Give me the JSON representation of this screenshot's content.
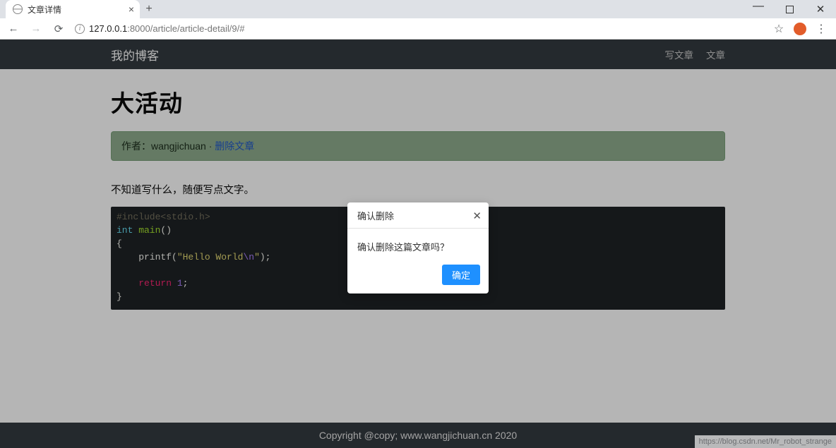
{
  "browser": {
    "tab_title": "文章详情",
    "url_prefix": "127.0.0.1",
    "url_rest": ":8000/article/article-detail/9/#",
    "status_url": "https://blog.csdn.net/Mr_robot_strange"
  },
  "navbar": {
    "brand": "我的博客",
    "links": {
      "write": "写文章",
      "articles": "文章"
    }
  },
  "article": {
    "title": "大活动",
    "meta_author_label": "作者：",
    "meta_author": "wangjichuan",
    "meta_sep": " · ",
    "meta_delete": "删除文章",
    "paragraph": "不知道写什么，随便写点文字。",
    "code": {
      "l1_pre": "#include<stdio.h>",
      "l2_type": "int",
      "l2_fn": " main",
      "l2_paren": "()",
      "l3": "{",
      "l4_indent": "    printf(",
      "l4_str1": "\"Hello World",
      "l4_esc": "\\n",
      "l4_str2": "\"",
      "l4_end": ");",
      "l5": "",
      "l6_indent": "    ",
      "l6_kw": "return",
      "l6_sp": " ",
      "l6_num": "1",
      "l6_semi": ";",
      "l7": "}"
    }
  },
  "footer": {
    "text": "Copyright @copy; www.wangjichuan.cn 2020"
  },
  "modal": {
    "title": "确认删除",
    "body": "确认删除这篇文章吗？",
    "ok": "确定"
  }
}
